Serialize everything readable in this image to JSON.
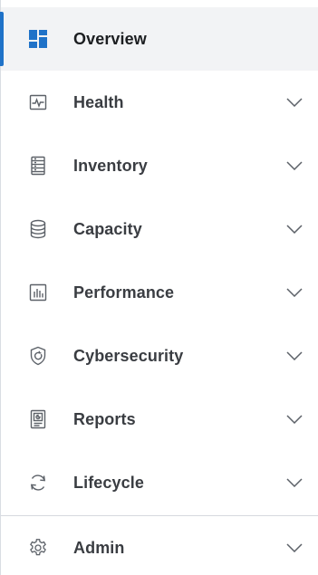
{
  "nav": {
    "items": [
      {
        "label": "Overview",
        "icon": "dashboard-grid-icon",
        "active": true,
        "expandable": false
      },
      {
        "label": "Health",
        "icon": "health-pulse-icon",
        "active": false,
        "expandable": true
      },
      {
        "label": "Inventory",
        "icon": "inventory-list-icon",
        "active": false,
        "expandable": true
      },
      {
        "label": "Capacity",
        "icon": "database-icon",
        "active": false,
        "expandable": true
      },
      {
        "label": "Performance",
        "icon": "bar-chart-icon",
        "active": false,
        "expandable": true
      },
      {
        "label": "Cybersecurity",
        "icon": "shield-icon",
        "active": false,
        "expandable": true
      },
      {
        "label": "Reports",
        "icon": "report-icon",
        "active": false,
        "expandable": true
      },
      {
        "label": "Lifecycle",
        "icon": "refresh-cycle-icon",
        "active": false,
        "expandable": true
      },
      {
        "label": "Admin",
        "icon": "gear-icon",
        "active": false,
        "expandable": true
      }
    ]
  },
  "colors": {
    "accent": "#1f72c8",
    "active_background": "#f2f3f5",
    "text": "#3a3d42",
    "icon": "#5c6168"
  }
}
